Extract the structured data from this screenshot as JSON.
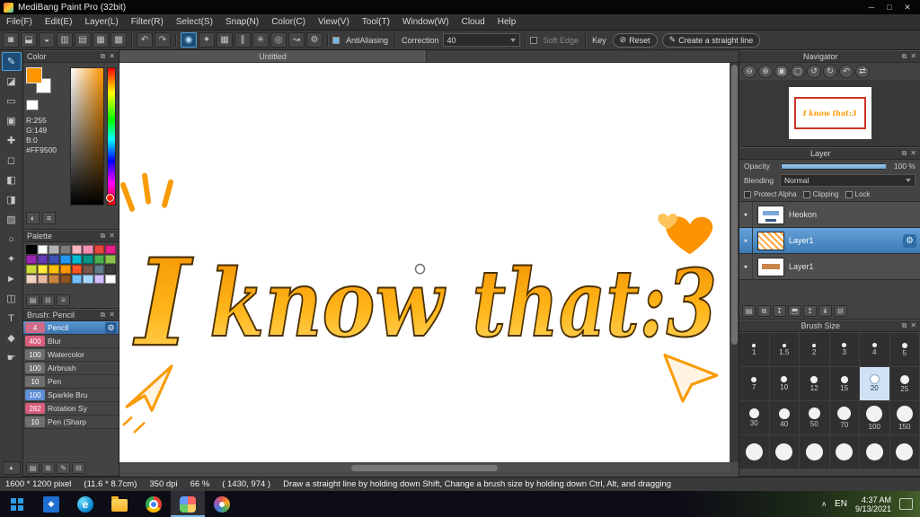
{
  "window": {
    "title": "MediBang Paint Pro (32bit)",
    "controls": {
      "minimize": "─",
      "maximize": "□",
      "close": "✕"
    }
  },
  "panels": {
    "popout_glyph": "⧉",
    "close_glyph": "✕"
  },
  "icons": {
    "gear": "⚙",
    "eye_dot": "●",
    "scroll_up": "▲"
  },
  "menu": {
    "items": [
      "File(F)",
      "Edit(E)",
      "Layer(L)",
      "Filter(R)",
      "Select(S)",
      "Snap(N)",
      "Color(C)",
      "View(V)",
      "Tool(T)",
      "Window(W)",
      "Cloud",
      "Help"
    ]
  },
  "toolbar": {
    "left_icons": [
      {
        "name": "dot-pen-icon",
        "glyph": "◙"
      },
      {
        "name": "export-icon",
        "glyph": "⬓"
      },
      {
        "name": "comment-icon",
        "glyph": "◒"
      },
      {
        "name": "panel-split-icon",
        "glyph": "▥"
      },
      {
        "name": "document-icon",
        "glyph": "▤"
      },
      {
        "name": "grid-icon",
        "glyph": "▦"
      },
      {
        "name": "material-icon",
        "glyph": "▩"
      }
    ],
    "history_icons": [
      {
        "name": "undo-icon",
        "glyph": "↶"
      },
      {
        "name": "redo-icon",
        "glyph": "↷"
      }
    ],
    "snap_icons": [
      {
        "name": "brush-tip-icon",
        "glyph": "◉",
        "active": true
      },
      {
        "name": "stabilizer-icon",
        "glyph": "✦"
      },
      {
        "name": "grid-snap-icon",
        "glyph": "▦"
      },
      {
        "name": "parallel-snap-icon",
        "glyph": "∥"
      },
      {
        "name": "cross-snap-icon",
        "glyph": "✳"
      },
      {
        "name": "vanishing-snap-icon",
        "glyph": "◎"
      },
      {
        "name": "curve-snap-icon",
        "glyph": "↝"
      },
      {
        "name": "snap-settings-gear-icon",
        "glyph": "⚙"
      }
    ],
    "antialiasing_label": "AntiAliasing",
    "correction_label": "Correction",
    "correction_value": "40",
    "soft_edge_label": "Soft Edge",
    "key_label": "Key",
    "reset_button": {
      "glyph": "⊘",
      "label": "Reset"
    },
    "straight_line_button": {
      "glyph": "✎",
      "label": "Create a straight line"
    }
  },
  "tool_strip": {
    "tools": [
      {
        "name": "pen-tool",
        "glyph": "✎",
        "active": true
      },
      {
        "name": "eraser-tool",
        "glyph": "◪"
      },
      {
        "name": "rect-select-tool",
        "glyph": "▭"
      },
      {
        "name": "stamp-tool",
        "glyph": "▣"
      },
      {
        "name": "move-tool",
        "glyph": "✚"
      },
      {
        "name": "transform-tool",
        "glyph": "◻"
      },
      {
        "name": "fill-tool",
        "glyph": "◧"
      },
      {
        "name": "bucket-tool",
        "glyph": "◨"
      },
      {
        "name": "gradient-tool",
        "glyph": "▨"
      },
      {
        "name": "lasso-tool",
        "glyph": "○"
      },
      {
        "name": "magic-wand-tool",
        "glyph": "✦"
      },
      {
        "name": "operation-tool",
        "glyph": "►"
      },
      {
        "name": "divide-tool",
        "glyph": "◫"
      },
      {
        "name": "text-tool",
        "glyph": "T"
      },
      {
        "name": "eyedropper-tool",
        "glyph": "◆"
      },
      {
        "name": "hand-tool",
        "glyph": "☛"
      }
    ]
  },
  "color_panel": {
    "title": "Color",
    "r_label": "R:255",
    "g_label": "G:149",
    "b_label": "B:0",
    "hex": "#FF9500",
    "foreground_color": "#FF9500",
    "hue_marker_color": "#FF2200",
    "tools": [
      {
        "name": "color-wheel-icon",
        "glyph": "◐"
      },
      {
        "name": "color-slider-icon",
        "glyph": "≡"
      }
    ]
  },
  "palette_panel": {
    "title": "Palette",
    "colors": [
      "#000000",
      "#ffffff",
      "#b4b4b4",
      "#7d7d7d",
      "#f7b6c2",
      "#f48fb1",
      "#e8453c",
      "#e91e8c",
      "#9c27b0",
      "#673ab7",
      "#3f51b5",
      "#2196f3",
      "#00bcd4",
      "#009688",
      "#4caf50",
      "#8bc34a",
      "#cddc39",
      "#ffeb3b",
      "#ffc107",
      "#ff9800",
      "#ff5722",
      "#795548",
      "#607d8b",
      "#3a3a3a",
      "#f2d5c4",
      "#e6b89c",
      "#c68642",
      "#8d5524",
      "#74c0fc",
      "#a5d8ff",
      "#d0bfff",
      "#ffffff"
    ],
    "tools": [
      {
        "name": "add-color-icon",
        "glyph": "▤"
      },
      {
        "name": "delete-color-icon",
        "glyph": "⊟"
      },
      {
        "name": "palette-menu-icon",
        "glyph": "≡"
      }
    ]
  },
  "brush_panel": {
    "title": "Brush: Pencil",
    "brushes": [
      {
        "size": "4",
        "name": "Pencil",
        "badge_color": "#cf6b8a",
        "selected": true
      },
      {
        "size": "400",
        "name": "Blur",
        "badge_color": "#d85c7c"
      },
      {
        "size": "100",
        "name": "Watercolor",
        "badge_color": "#6f6f6f"
      },
      {
        "size": "100",
        "name": "Airbrush",
        "badge_color": "#6f6f6f"
      },
      {
        "size": "10",
        "name": "Pen",
        "badge_color": "#6f6f6f"
      },
      {
        "size": "100",
        "name": "Sparkle Bru",
        "badge_color": "#5f8fd6"
      },
      {
        "size": "282",
        "name": "Rotation Sy",
        "badge_color": "#d85c7c"
      },
      {
        "size": "10",
        "name": "Pen (Sharp",
        "badge_color": "#6f6f6f"
      }
    ],
    "tools": [
      {
        "name": "add-brush-icon",
        "glyph": "▤"
      },
      {
        "name": "duplicate-brush-icon",
        "glyph": "⧉"
      },
      {
        "name": "edit-brush-icon",
        "glyph": "✎"
      },
      {
        "name": "delete-brush-icon",
        "glyph": "⊟"
      }
    ]
  },
  "canvas": {
    "tab": "Untitled",
    "artwork": {
      "words": [
        "I",
        "know",
        "that:3"
      ],
      "color": "#FFA321",
      "decorations": [
        "emphasis-marks",
        "heart",
        "small-heart",
        "paper-plane-left",
        "paper-plane-right",
        "cursor-circle"
      ]
    }
  },
  "navigator": {
    "title": "Navigator",
    "thumbnail_text": "I know that:3",
    "buttons": [
      {
        "name": "zoom-out-icon",
        "glyph": "⊖"
      },
      {
        "name": "zoom-in-icon",
        "glyph": "⊕"
      },
      {
        "name": "fit-window-icon",
        "glyph": "▣"
      },
      {
        "name": "actual-size-icon",
        "glyph": "▢"
      },
      {
        "name": "rotate-left-icon",
        "glyph": "↺"
      },
      {
        "name": "rotate-right-icon",
        "glyph": "↻"
      },
      {
        "name": "reset-rotation-icon",
        "glyph": "↶"
      },
      {
        "name": "flip-icon",
        "glyph": "⇄"
      }
    ]
  },
  "layer_panel": {
    "title": "Layer",
    "opacity_label": "Opacity",
    "opacity_value": "100 %",
    "blending_label": "Blending",
    "blending_value": "Normal",
    "protect_alpha_label": "Protect Alpha",
    "clipping_label": "Clipping",
    "lock_label": "Lock",
    "layers": [
      {
        "name": "Heokon",
        "thumb": "heokon"
      },
      {
        "name": "Layer1",
        "thumb": "dots",
        "selected": true
      },
      {
        "name": "Layer1",
        "thumb": "text"
      }
    ],
    "tools": [
      {
        "name": "new-layer-icon",
        "glyph": "▤"
      },
      {
        "name": "duplicate-layer-icon",
        "glyph": "⧉"
      },
      {
        "name": "layer-down-icon",
        "glyph": "↧"
      },
      {
        "name": "folder-icon",
        "glyph": "⬒"
      },
      {
        "name": "layer-up-icon",
        "glyph": "↥"
      },
      {
        "name": "merge-layer-icon",
        "glyph": "↡"
      },
      {
        "name": "delete-layer-icon",
        "glyph": "⊟"
      }
    ]
  },
  "brush_size_panel": {
    "title": "Brush Size",
    "sizes": [
      "1",
      "1.5",
      "2",
      "3",
      "4",
      "5",
      "7",
      "10",
      "12",
      "15",
      "20",
      "25",
      "30",
      "40",
      "50",
      "70",
      "100",
      "150"
    ],
    "selected": "20",
    "extra_cells": 6
  },
  "status_bar": {
    "items": [
      "1600 * 1200 pixel",
      "(11.6 * 8.7cm)",
      "350 dpi",
      "66 %",
      "( 1430, 974 )",
      "Draw a straight line by holding down Shift, Change a brush size by holding down Ctrl, Alt, and dragging"
    ]
  },
  "taskbar": {
    "apps": [
      {
        "name": "start"
      },
      {
        "name": "photos"
      },
      {
        "name": "edge"
      },
      {
        "name": "explorer"
      },
      {
        "name": "chrome"
      },
      {
        "name": "medibang",
        "active": true
      },
      {
        "name": "paint"
      }
    ],
    "tray": {
      "chevron": "∧",
      "language": "EN",
      "time": "4:37 AM",
      "date": "9/13/2021"
    }
  }
}
